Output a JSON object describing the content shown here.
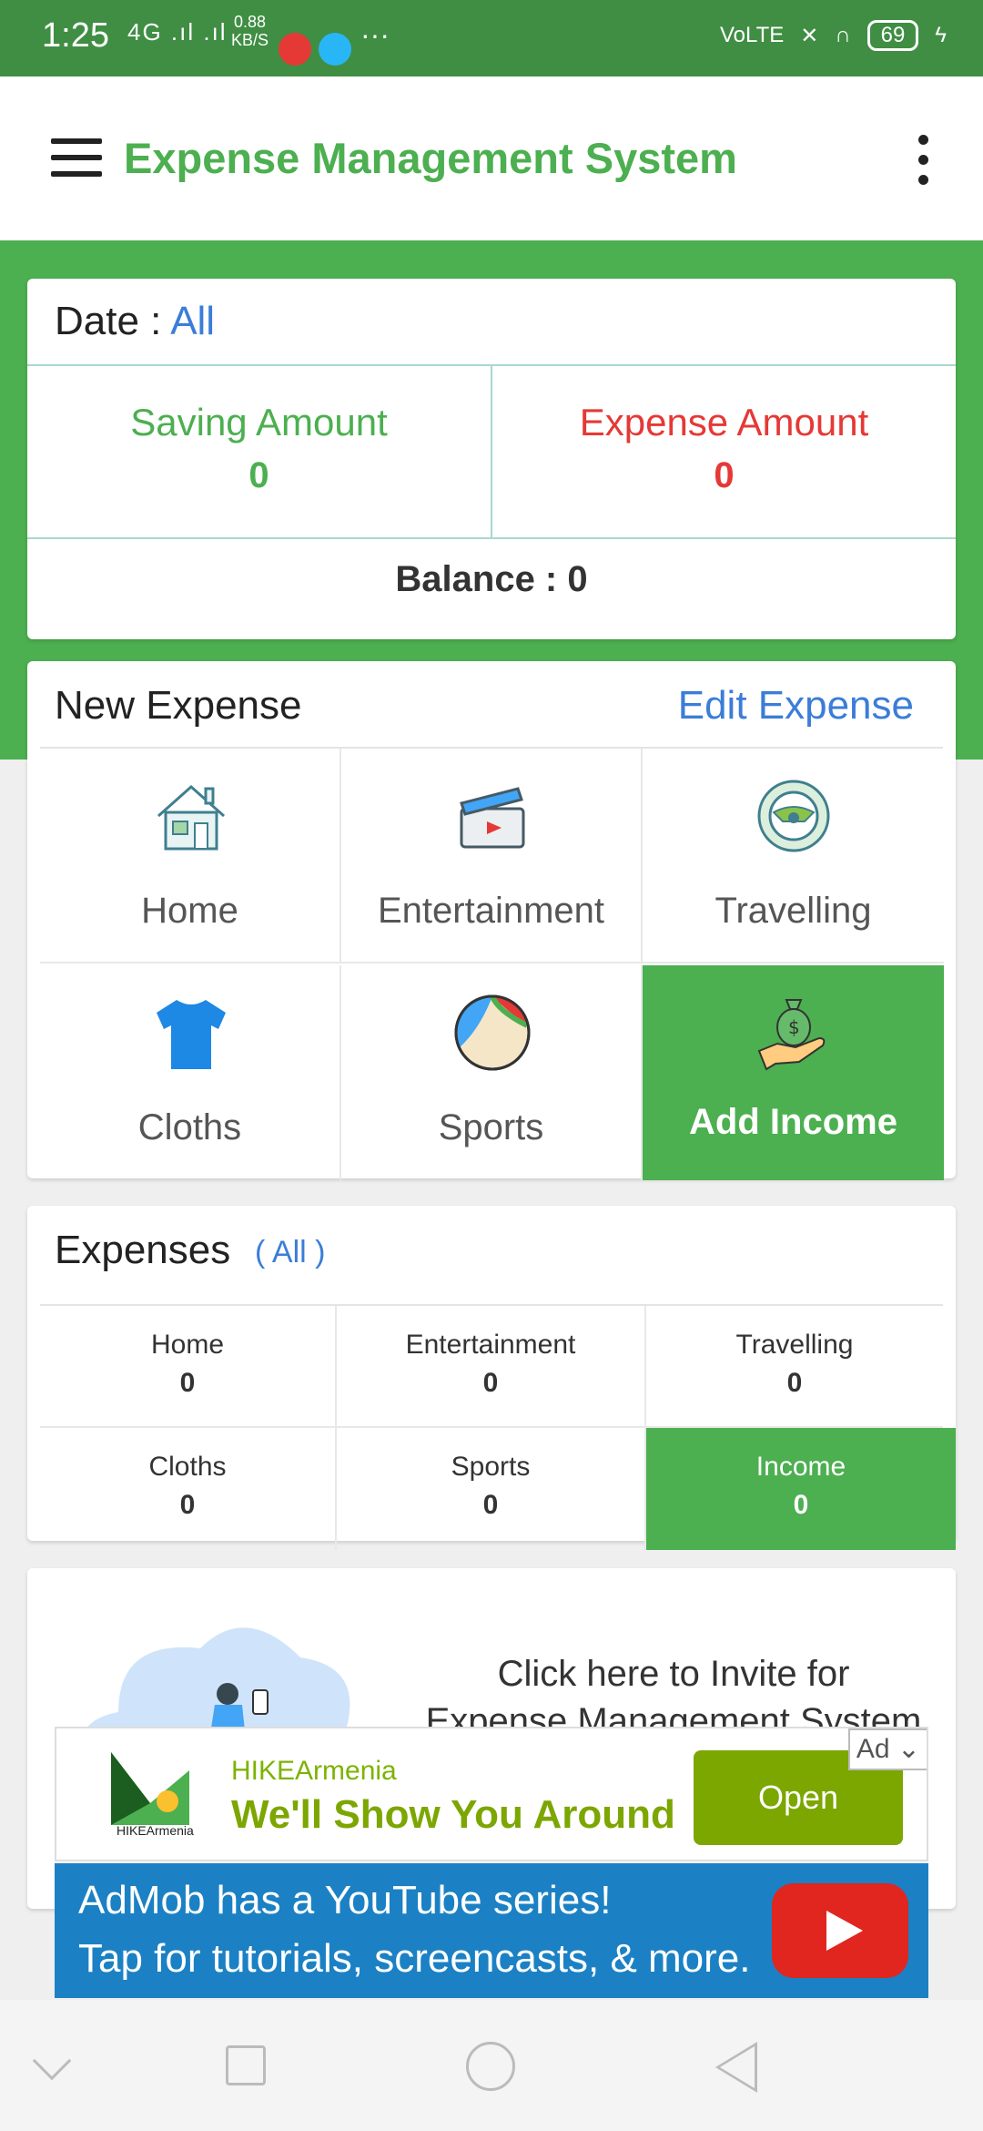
{
  "status_bar": {
    "time": "1:25",
    "network": "4G .ıl .ıl",
    "speed": "0.88\nKB/S",
    "more": "···",
    "volte": "VoLTE",
    "battery": "69"
  },
  "app_bar": {
    "title": "Expense Management System"
  },
  "summary": {
    "date_label": "Date : ",
    "date_value": "All",
    "saving_label": "Saving Amount",
    "saving_value": "0",
    "expense_label": "Expense Amount",
    "expense_value": "0",
    "balance": "Balance : 0"
  },
  "new_expense": {
    "title": "New Expense",
    "edit_label": "Edit Expense",
    "tiles": [
      {
        "label": "Home",
        "icon": "home-icon"
      },
      {
        "label": "Entertainment",
        "icon": "clapperboard-icon"
      },
      {
        "label": "Travelling",
        "icon": "steering-wheel-icon"
      },
      {
        "label": "Cloths",
        "icon": "tshirt-icon"
      },
      {
        "label": "Sports",
        "icon": "beach-ball-icon"
      },
      {
        "label": "Add Income",
        "icon": "money-bag-hand-icon"
      }
    ]
  },
  "expenses": {
    "title": "Expenses",
    "filter": "( All )",
    "cells": [
      {
        "label": "Home",
        "value": "0"
      },
      {
        "label": "Entertainment",
        "value": "0"
      },
      {
        "label": "Travelling",
        "value": "0"
      },
      {
        "label": "Cloths",
        "value": "0"
      },
      {
        "label": "Sports",
        "value": "0"
      },
      {
        "label": "Income",
        "value": "0"
      }
    ]
  },
  "invite": {
    "line1": "Click here to Invite for",
    "line2": "Expense Management System"
  },
  "ad": {
    "brand": "HIKEArmenia",
    "headline": "We'll Show You Around",
    "logo_text": "HIKEArmenia",
    "button": "Open",
    "tag": "Ad ⌄"
  },
  "banner": {
    "line1": "AdMob has a YouTube series!",
    "line2": "Tap for tutorials, screencasts, & more."
  },
  "colors": {
    "primary": "#4caf50",
    "expense": "#e53935",
    "link": "#3b7dd8"
  }
}
